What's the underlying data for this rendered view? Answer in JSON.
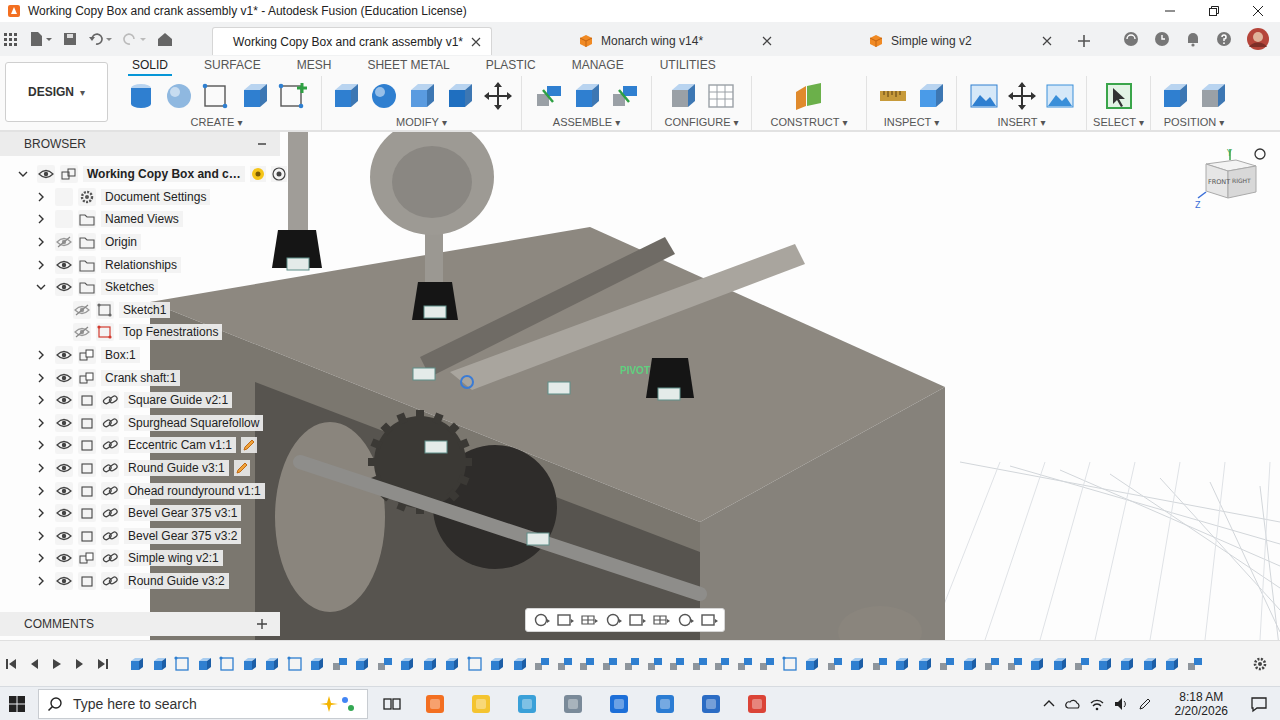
{
  "window": {
    "title": "Working Copy Box and crank assembly v1* - Autodesk Fusion (Education License)"
  },
  "doc_tabs": [
    {
      "label": "Working Copy Box and crank assembly v1*",
      "selected": true
    },
    {
      "label": "Monarch wing v14*",
      "selected": false
    },
    {
      "label": "Simple wing v2",
      "selected": false
    }
  ],
  "caret": "▾",
  "workspace": {
    "label": "DESIGN"
  },
  "ribbon_tabs": [
    {
      "label": "SOLID",
      "selected": true
    },
    {
      "label": "SURFACE",
      "selected": false
    },
    {
      "label": "MESH",
      "selected": false
    },
    {
      "label": "SHEET METAL",
      "selected": false
    },
    {
      "label": "PLASTIC",
      "selected": false
    },
    {
      "label": "MANAGE",
      "selected": false
    },
    {
      "label": "UTILITIES",
      "selected": false
    }
  ],
  "ribbon_groups": [
    {
      "label": "CREATE"
    },
    {
      "label": "MODIFY"
    },
    {
      "label": "ASSEMBLE"
    },
    {
      "label": "CONFIGURE"
    },
    {
      "label": "CONSTRUCT"
    },
    {
      "label": "INSPECT"
    },
    {
      "label": "INSERT"
    },
    {
      "label": "SELECT"
    },
    {
      "label": "POSITION"
    }
  ],
  "browser": {
    "title": "BROWSER",
    "items": [
      {
        "label": "Working Copy Box and c…",
        "depth": 0,
        "expandable": true,
        "expanded": true,
        "eye": true,
        "visible": true,
        "kind": "root",
        "linked": false,
        "edited": false,
        "error": false
      },
      {
        "label": "Document Settings",
        "depth": 1,
        "expandable": true,
        "expanded": false,
        "eye": false,
        "visible": true,
        "kind": "settings",
        "linked": false,
        "edited": false,
        "error": false
      },
      {
        "label": "Named Views",
        "depth": 1,
        "expandable": true,
        "expanded": false,
        "eye": false,
        "visible": true,
        "kind": "folder",
        "linked": false,
        "edited": false,
        "error": false
      },
      {
        "label": "Origin",
        "depth": 1,
        "expandable": true,
        "expanded": false,
        "eye": true,
        "visible": false,
        "kind": "folder",
        "linked": false,
        "edited": false,
        "error": false
      },
      {
        "label": "Relationships",
        "depth": 1,
        "expandable": true,
        "expanded": false,
        "eye": true,
        "visible": true,
        "kind": "folder",
        "linked": false,
        "edited": false,
        "error": false
      },
      {
        "label": "Sketches",
        "depth": 1,
        "expandable": true,
        "expanded": true,
        "eye": true,
        "visible": true,
        "kind": "folder",
        "linked": false,
        "edited": false,
        "error": false
      },
      {
        "label": "Sketch1",
        "depth": 2,
        "expandable": false,
        "expanded": false,
        "eye": true,
        "visible": false,
        "kind": "sketch",
        "linked": false,
        "edited": false,
        "error": false
      },
      {
        "label": "Top Fenestrations",
        "depth": 2,
        "expandable": false,
        "expanded": false,
        "eye": true,
        "visible": false,
        "kind": "sketch",
        "linked": false,
        "edited": false,
        "error": true
      },
      {
        "label": "Box:1",
        "depth": 1,
        "expandable": true,
        "expanded": false,
        "eye": true,
        "visible": true,
        "kind": "component",
        "linked": false,
        "edited": false,
        "error": false
      },
      {
        "label": "Crank shaft:1",
        "depth": 1,
        "expandable": true,
        "expanded": false,
        "eye": true,
        "visible": true,
        "kind": "component",
        "linked": false,
        "edited": false,
        "error": false
      },
      {
        "label": "Square Guide v2:1",
        "depth": 1,
        "expandable": true,
        "expanded": false,
        "eye": true,
        "visible": true,
        "kind": "body",
        "linked": true,
        "edited": false,
        "error": false
      },
      {
        "label": "Spurghead Squarefollow",
        "depth": 1,
        "expandable": true,
        "expanded": false,
        "eye": true,
        "visible": true,
        "kind": "body",
        "linked": true,
        "edited": false,
        "error": false
      },
      {
        "label": "Eccentric Cam v1:1",
        "depth": 1,
        "expandable": true,
        "expanded": false,
        "eye": true,
        "visible": true,
        "kind": "body",
        "linked": true,
        "edited": true,
        "error": false
      },
      {
        "label": "Round Guide v3:1",
        "depth": 1,
        "expandable": true,
        "expanded": false,
        "eye": true,
        "visible": true,
        "kind": "body",
        "linked": true,
        "edited": true,
        "error": false
      },
      {
        "label": "Ohead roundyround v1:1",
        "depth": 1,
        "expandable": true,
        "expanded": false,
        "eye": true,
        "visible": true,
        "kind": "body",
        "linked": true,
        "edited": false,
        "error": false
      },
      {
        "label": "Bevel Gear 375 v3:1",
        "depth": 1,
        "expandable": true,
        "expanded": false,
        "eye": true,
        "visible": true,
        "kind": "body",
        "linked": true,
        "edited": false,
        "error": false
      },
      {
        "label": "Bevel Gear 375 v3:2",
        "depth": 1,
        "expandable": true,
        "expanded": false,
        "eye": true,
        "visible": true,
        "kind": "body",
        "linked": true,
        "edited": false,
        "error": false
      },
      {
        "label": "Simple wing v2:1",
        "depth": 1,
        "expandable": true,
        "expanded": false,
        "eye": true,
        "visible": true,
        "kind": "component",
        "linked": true,
        "edited": false,
        "error": false
      },
      {
        "label": "Round Guide v3:2",
        "depth": 1,
        "expandable": true,
        "expanded": false,
        "eye": true,
        "visible": true,
        "kind": "body",
        "linked": true,
        "edited": false,
        "error": false
      }
    ]
  },
  "viewport": {
    "labels": [
      {
        "text": "PIVOT"
      }
    ],
    "viewcube": {
      "front": "FRONT",
      "right": "RIGHT",
      "y": "Y",
      "z": "Z"
    }
  },
  "comments": {
    "title": "COMMENTS"
  },
  "taskbar": {
    "search_placeholder": "Type here to search",
    "time": "8:18 AM",
    "date": "2/20/2026"
  }
}
